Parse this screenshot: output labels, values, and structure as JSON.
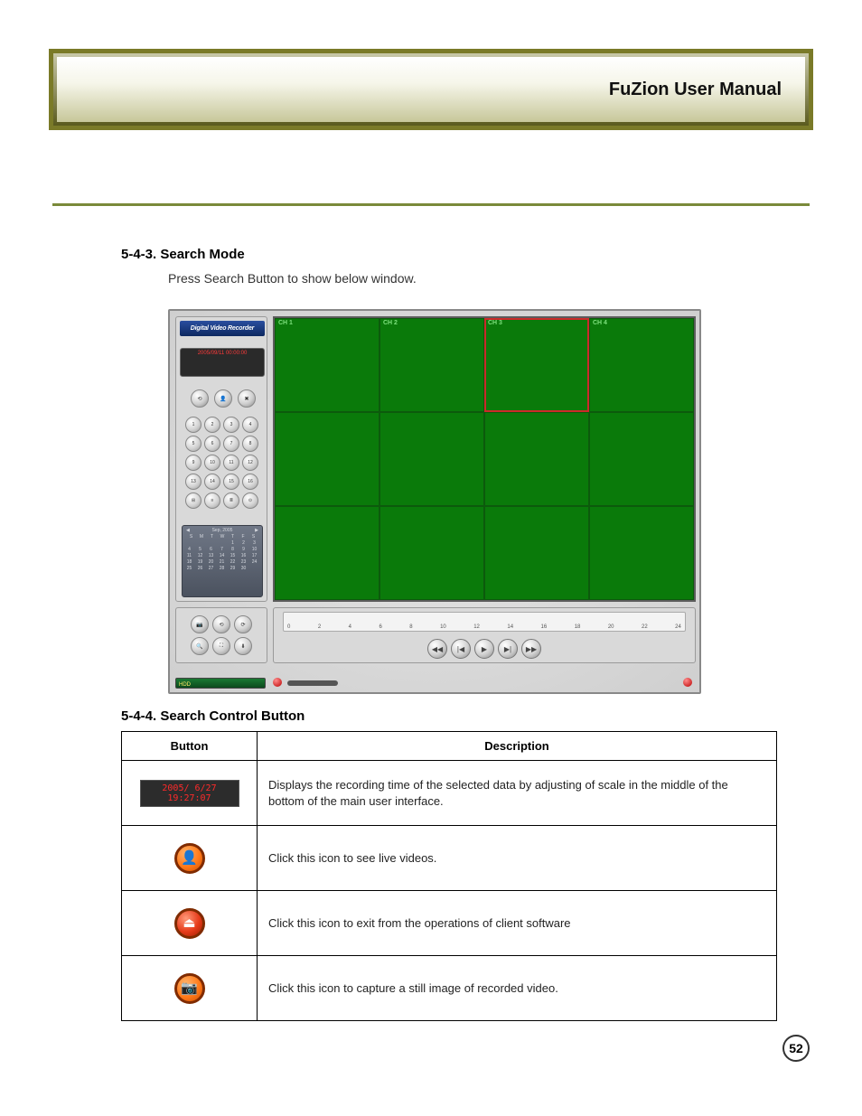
{
  "banner": {
    "title": "FuZion User Manual"
  },
  "section1": {
    "heading": "5-4-3. Search Mode",
    "body": "Press Search Button to show below window."
  },
  "dvr": {
    "logo": "Digital Video Recorder",
    "timestamp": "2005/09/11 00:00:00",
    "numpad": [
      "1",
      "2",
      "3",
      "4",
      "5",
      "6",
      "7",
      "8",
      "9",
      "10",
      "11",
      "12",
      "13",
      "14",
      "15",
      "16",
      "⊞",
      "≡",
      "≣",
      "⊙"
    ],
    "controls_top": [
      "⟲",
      "👤",
      "✖"
    ],
    "calendar": {
      "month": "Sep, 2005",
      "dow": [
        "S",
        "M",
        "T",
        "W",
        "T",
        "F",
        "S"
      ],
      "days": [
        "",
        "",
        "",
        "",
        "1",
        "2",
        "3",
        "4",
        "5",
        "6",
        "7",
        "8",
        "9",
        "10",
        "11",
        "12",
        "13",
        "14",
        "15",
        "16",
        "17",
        "18",
        "19",
        "20",
        "21",
        "22",
        "23",
        "24",
        "25",
        "26",
        "27",
        "28",
        "29",
        "30",
        ""
      ]
    },
    "bottom_buttons": [
      "📷",
      "⟲",
      "⟳",
      "🔍",
      "⛶",
      "⬇"
    ],
    "channels": [
      "CH 1",
      "CH 2",
      "CH 3",
      "CH 4"
    ],
    "ruler": [
      "0",
      "2",
      "4",
      "6",
      "8",
      "10",
      "12",
      "14",
      "16",
      "18",
      "20",
      "22",
      "24"
    ],
    "play": [
      "◀◀",
      "|◀",
      "▶",
      "▶|",
      "▶▶"
    ],
    "hdd": "HDD"
  },
  "section2": {
    "heading": "5-4-4. Search Control Button",
    "col1": "Button",
    "col2": "Description",
    "rows": [
      {
        "badge": "2005/ 6/27 19:27:07",
        "desc": "Displays the recording time of the selected data by adjusting of scale in the middle of the bottom of the main user interface."
      },
      {
        "icon": "live",
        "glyph": "👤",
        "desc": "Click this icon to see live videos."
      },
      {
        "icon": "exit",
        "glyph": "⏏",
        "desc": "Click this icon to exit from the operations of client software"
      },
      {
        "icon": "capture",
        "glyph": "📷",
        "desc": "Click this icon to capture a still image of recorded video."
      }
    ]
  },
  "page": "52"
}
